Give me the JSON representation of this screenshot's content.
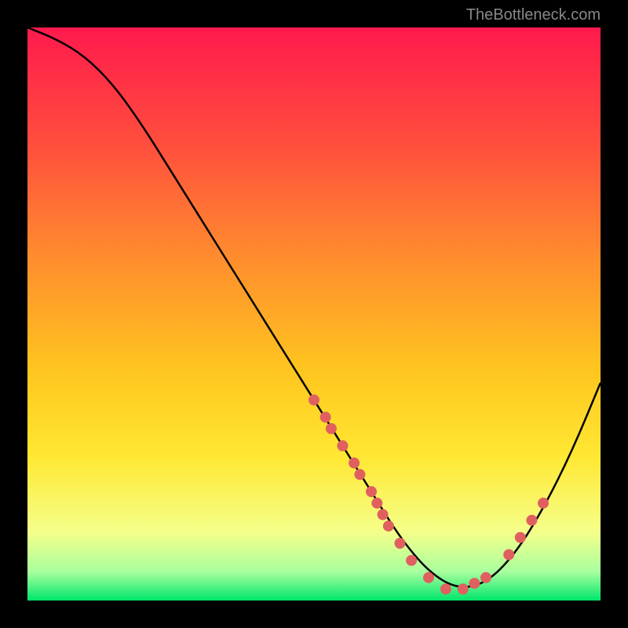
{
  "watermark": "TheBottleneck.com",
  "chart_data": {
    "type": "line",
    "title": "",
    "xlabel": "",
    "ylabel": "",
    "xlim": [
      0,
      100
    ],
    "ylim": [
      0,
      100
    ],
    "curve": {
      "description": "Bottleneck curve showing performance dip",
      "x": [
        0,
        5,
        10,
        15,
        20,
        25,
        30,
        35,
        40,
        45,
        50,
        55,
        60,
        65,
        70,
        75,
        80,
        85,
        90,
        95,
        100
      ],
      "y": [
        100,
        98,
        95,
        90,
        83,
        75,
        67,
        59,
        51,
        43,
        35,
        27,
        19,
        11,
        5,
        2,
        3,
        8,
        16,
        26,
        38
      ]
    },
    "markers": {
      "description": "Highlighted data points on curve",
      "points": [
        {
          "x": 50,
          "y": 35
        },
        {
          "x": 52,
          "y": 32
        },
        {
          "x": 53,
          "y": 30
        },
        {
          "x": 55,
          "y": 27
        },
        {
          "x": 57,
          "y": 24
        },
        {
          "x": 58,
          "y": 22
        },
        {
          "x": 60,
          "y": 19
        },
        {
          "x": 61,
          "y": 17
        },
        {
          "x": 62,
          "y": 15
        },
        {
          "x": 63,
          "y": 13
        },
        {
          "x": 65,
          "y": 10
        },
        {
          "x": 67,
          "y": 7
        },
        {
          "x": 70,
          "y": 4
        },
        {
          "x": 73,
          "y": 2
        },
        {
          "x": 76,
          "y": 2
        },
        {
          "x": 78,
          "y": 3
        },
        {
          "x": 80,
          "y": 4
        },
        {
          "x": 84,
          "y": 8
        },
        {
          "x": 86,
          "y": 11
        },
        {
          "x": 88,
          "y": 14
        },
        {
          "x": 90,
          "y": 17
        }
      ]
    },
    "gradient_stops": [
      {
        "offset": 0,
        "color": "#ff1a4d"
      },
      {
        "offset": 20,
        "color": "#ff4d3d"
      },
      {
        "offset": 40,
        "color": "#ff8c2e"
      },
      {
        "offset": 60,
        "color": "#ffc61f"
      },
      {
        "offset": 75,
        "color": "#ffe833"
      },
      {
        "offset": 88,
        "color": "#f5ff8a"
      },
      {
        "offset": 95,
        "color": "#a8ff9e"
      },
      {
        "offset": 100,
        "color": "#00e56b"
      }
    ]
  }
}
